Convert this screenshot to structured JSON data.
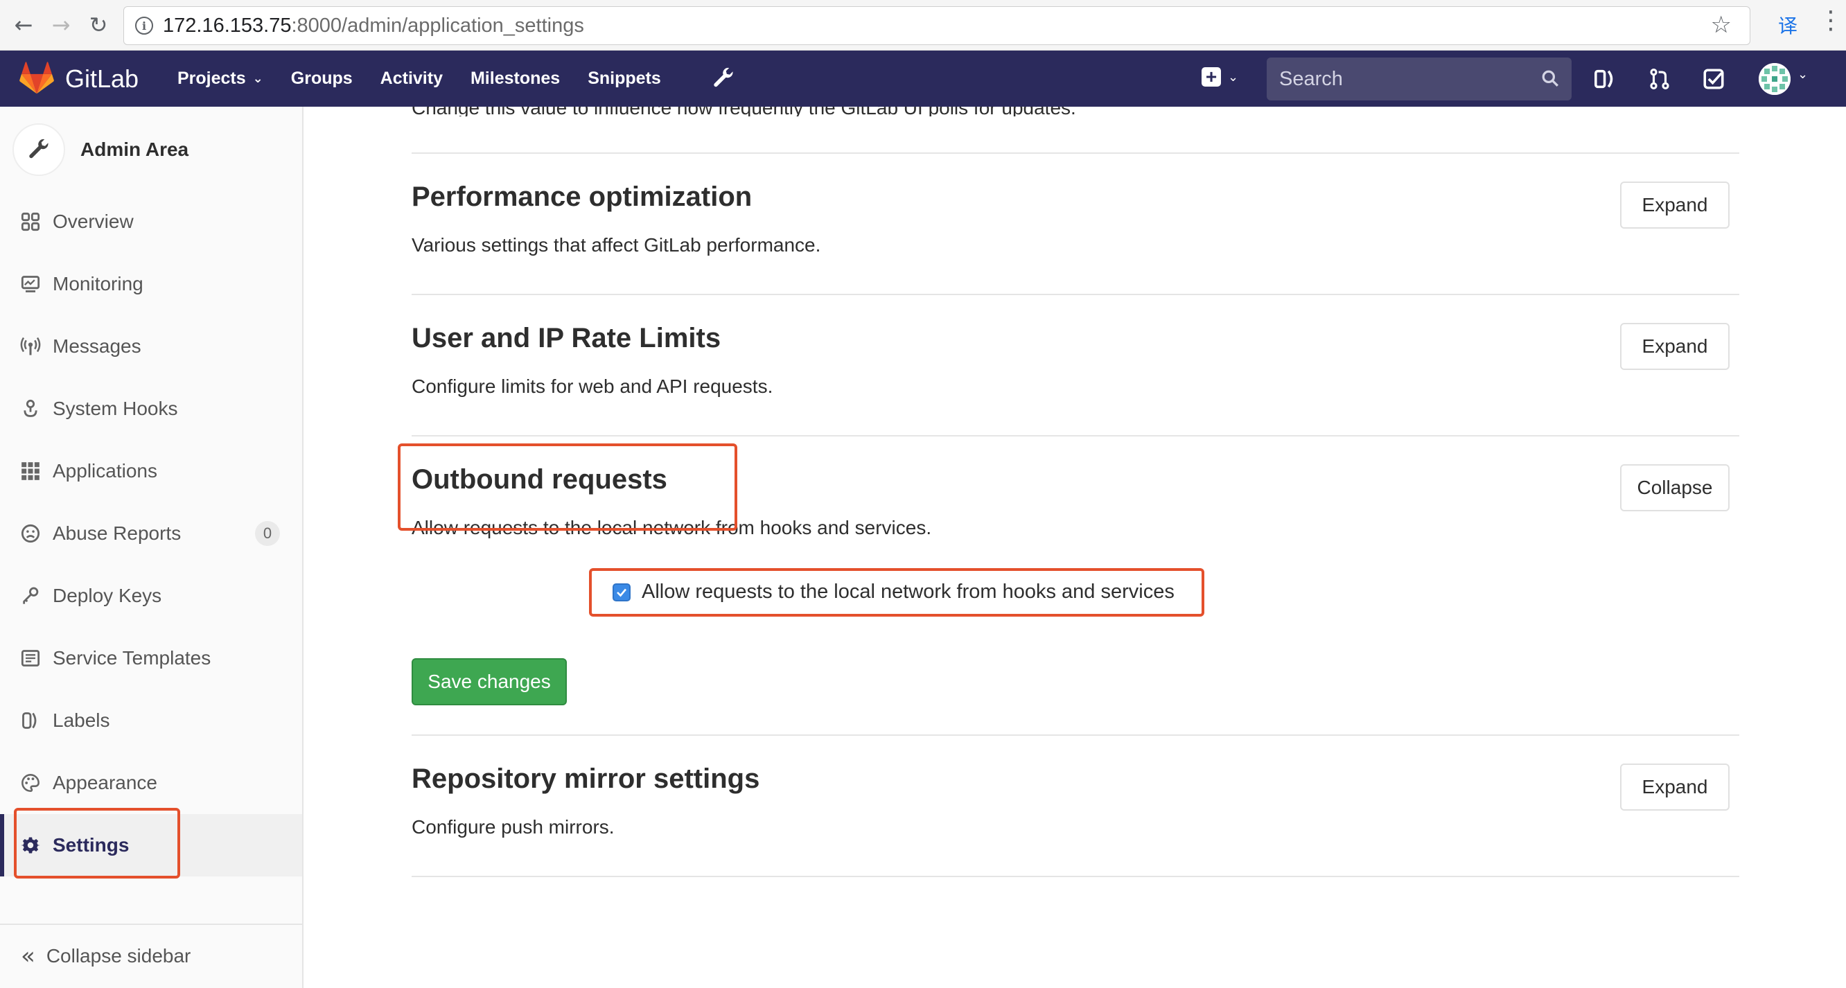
{
  "browser": {
    "url_host": "172.16.153.75",
    "url_rest": ":8000/admin/application_settings",
    "back_icon": "arrow-left-icon",
    "forward_icon": "arrow-right-icon",
    "reload_icon": "reload-icon",
    "translate_glyph": "译"
  },
  "header": {
    "brand": "GitLab",
    "nav": [
      {
        "label": "Projects",
        "has_dropdown": true
      },
      {
        "label": "Groups"
      },
      {
        "label": "Activity"
      },
      {
        "label": "Milestones"
      },
      {
        "label": "Snippets"
      }
    ],
    "search_placeholder": "Search",
    "colors": {
      "header_bg": "#2b2a5c",
      "accent_orange": "#fc6d26"
    }
  },
  "sidebar": {
    "title": "Admin Area",
    "items": [
      {
        "label": "Overview",
        "icon": "grid-icon"
      },
      {
        "label": "Monitoring",
        "icon": "monitor-icon"
      },
      {
        "label": "Messages",
        "icon": "broadcast-icon"
      },
      {
        "label": "System Hooks",
        "icon": "hook-icon"
      },
      {
        "label": "Applications",
        "icon": "apps-grid-icon"
      },
      {
        "label": "Abuse Reports",
        "icon": "frown-icon",
        "badge": "0"
      },
      {
        "label": "Deploy Keys",
        "icon": "key-icon"
      },
      {
        "label": "Service Templates",
        "icon": "template-icon"
      },
      {
        "label": "Labels",
        "icon": "labels-icon"
      },
      {
        "label": "Appearance",
        "icon": "palette-icon"
      },
      {
        "label": "Settings",
        "icon": "gear-icon",
        "active": true
      }
    ],
    "collapse_label": "Collapse sidebar"
  },
  "main": {
    "cut_text": "Change this value to influence how frequently the GitLab UI polls for updates.",
    "sections": [
      {
        "title": "Performance optimization",
        "desc": "Various settings that affect GitLab performance.",
        "button": "Expand"
      },
      {
        "title": "User and IP Rate Limits",
        "desc": "Configure limits for web and API requests.",
        "button": "Expand"
      },
      {
        "title": "Outbound requests",
        "desc": "Allow requests to the local network from hooks and services.",
        "button": "Collapse"
      },
      {
        "title": "Repository mirror settings",
        "desc": "Configure push mirrors.",
        "button": "Expand"
      }
    ],
    "outbound": {
      "checkbox_label": "Allow requests to the local network from hooks and services",
      "checked": true,
      "save_label": "Save changes"
    }
  },
  "annotation_color": "#e4502c"
}
